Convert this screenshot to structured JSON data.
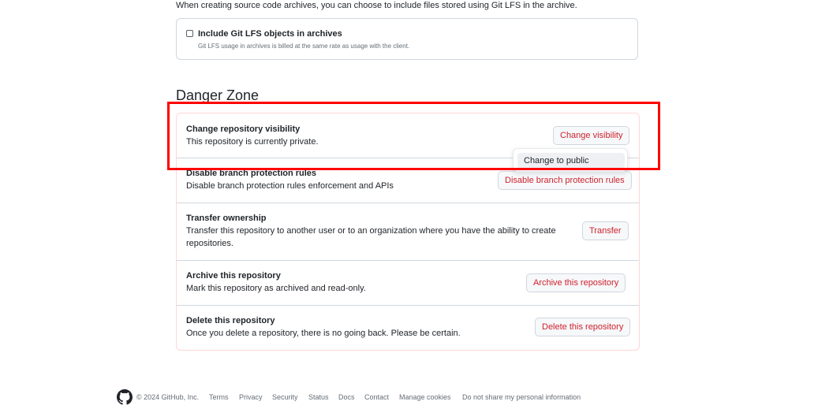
{
  "lfs": {
    "intro": "When creating source code archives, you can choose to include files stored using Git LFS in the archive.",
    "checkbox_label": "Include Git LFS objects in archives",
    "note": "Git LFS usage in archives is billed at the same rate as usage with the client."
  },
  "danger": {
    "title": "Danger Zone",
    "visibility": {
      "title": "Change repository visibility",
      "desc": "This repository is currently private.",
      "button": "Change visibility",
      "menu_item": "Change to public"
    },
    "branch": {
      "title": "Disable branch protection rules",
      "desc": "Disable branch protection rules enforcement and APIs",
      "button": "Disable branch protection rules"
    },
    "transfer": {
      "title": "Transfer ownership",
      "desc": "Transfer this repository to another user or to an organization where you have the ability to create repositories.",
      "button": "Transfer"
    },
    "archive": {
      "title": "Archive this repository",
      "desc": "Mark this repository as archived and read-only.",
      "button": "Archive this repository"
    },
    "delete": {
      "title": "Delete this repository",
      "desc": "Once you delete a repository, there is no going back. Please be certain.",
      "button": "Delete this repository"
    }
  },
  "footer": {
    "icon": "github-logo-icon",
    "copyright": "© 2024 GitHub, Inc.",
    "links": [
      "Terms",
      "Privacy",
      "Security",
      "Status",
      "Docs",
      "Contact",
      "Manage cookies",
      "Do not share my personal information"
    ]
  },
  "colors": {
    "danger": "#cf222e",
    "danger_border": "#ffd7d5",
    "highlight": "#ff0000"
  }
}
